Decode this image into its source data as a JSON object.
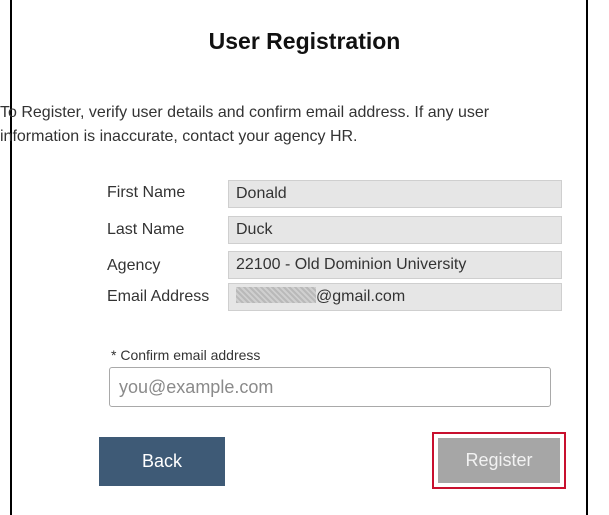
{
  "page": {
    "title": "User Registration",
    "intro_line1": "To Register, verify user details and confirm email address. If any user",
    "intro_line2": "information is inaccurate, contact your agency HR."
  },
  "details": {
    "first_name_label": "First Name",
    "first_name_value": "Donald",
    "last_name_label": "Last Name",
    "last_name_value": "Duck",
    "agency_label": "Agency",
    "agency_value": "22100 - Old Dominion University",
    "email_label": "Email Address",
    "email_domain": "@gmail.com"
  },
  "confirm_email": {
    "label": "* Confirm email address",
    "value": "",
    "placeholder": "you@example.com"
  },
  "buttons": {
    "back_label": "Back",
    "register_label": "Register"
  },
  "colors": {
    "back_button": "#3e5a76",
    "register_button_disabled": "#a6a6a6",
    "highlight_outline": "#c8102e",
    "readonly_field": "#e6e6e6"
  }
}
